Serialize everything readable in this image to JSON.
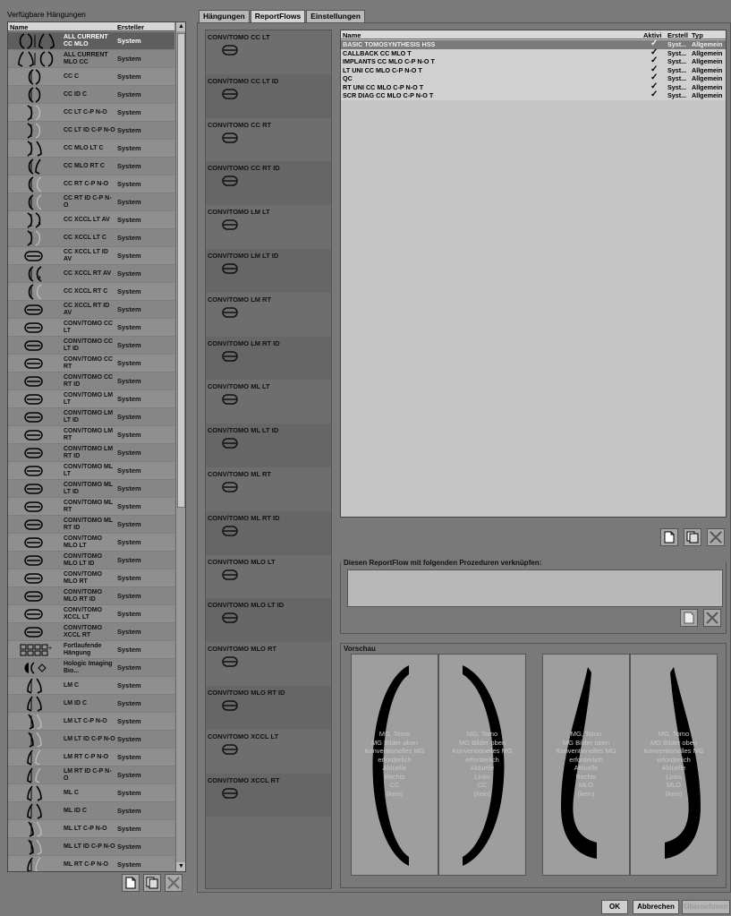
{
  "left": {
    "title": "Verfügbare Hängungen",
    "col_name": "Name",
    "col_creator": "Ersteller",
    "scroll_up": "▲",
    "scroll_down": "▼",
    "rows": [
      {
        "icon": "cc-mlo-pair-icon",
        "name": "ALL CURRENT CC MLO",
        "creator": "System",
        "selected": true
      },
      {
        "icon": "mlo-cc-pair-icon",
        "name": "ALL CURRENT MLO CC",
        "creator": "System"
      },
      {
        "icon": "cc-icon",
        "name": "CC C",
        "creator": "System"
      },
      {
        "icon": "cc-icon",
        "name": "CC ID C",
        "creator": "System"
      },
      {
        "icon": "cc-lt-icon",
        "name": "CC LT C-P N-O",
        "creator": "System"
      },
      {
        "icon": "cc-lt-icon",
        "name": "CC LT ID C-P N-O",
        "creator": "System"
      },
      {
        "icon": "cc-mlo-lt-icon",
        "name": "CC MLO LT C",
        "creator": "System"
      },
      {
        "icon": "cc-mlo-rt-icon",
        "name": "CC MLO RT C",
        "creator": "System"
      },
      {
        "icon": "cc-rt-icon",
        "name": "CC RT C-P N-O",
        "creator": "System"
      },
      {
        "icon": "cc-rt-icon",
        "name": "CC RT ID C-P N-O",
        "creator": "System"
      },
      {
        "icon": "cc-xccl-lt-icon",
        "name": "CC XCCL LT AV",
        "creator": "System"
      },
      {
        "icon": "cc-lt-icon",
        "name": "CC XCCL LT C",
        "creator": "System"
      },
      {
        "icon": "conv-tomo-icon",
        "name": "CC XCCL LT ID AV",
        "creator": "System"
      },
      {
        "icon": "cc-xccl-rt-icon",
        "name": "CC XCCL RT AV",
        "creator": "System"
      },
      {
        "icon": "cc-rt-icon",
        "name": "CC XCCL RT C",
        "creator": "System"
      },
      {
        "icon": "conv-tomo-icon",
        "name": "CC XCCL RT ID AV",
        "creator": "System"
      },
      {
        "icon": "conv-tomo-icon",
        "name": "CONV/TOMO CC LT",
        "creator": "System"
      },
      {
        "icon": "conv-tomo-icon",
        "name": "CONV/TOMO CC LT ID",
        "creator": "System"
      },
      {
        "icon": "conv-tomo-icon",
        "name": "CONV/TOMO CC RT",
        "creator": "System"
      },
      {
        "icon": "conv-tomo-icon",
        "name": "CONV/TOMO CC RT ID",
        "creator": "System"
      },
      {
        "icon": "conv-tomo-icon",
        "name": "CONV/TOMO LM LT",
        "creator": "System"
      },
      {
        "icon": "conv-tomo-icon",
        "name": "CONV/TOMO LM LT ID",
        "creator": "System"
      },
      {
        "icon": "conv-tomo-icon",
        "name": "CONV/TOMO LM RT",
        "creator": "System"
      },
      {
        "icon": "conv-tomo-icon",
        "name": "CONV/TOMO LM RT ID",
        "creator": "System"
      },
      {
        "icon": "conv-tomo-icon",
        "name": "CONV/TOMO ML LT",
        "creator": "System"
      },
      {
        "icon": "conv-tomo-icon",
        "name": "CONV/TOMO ML LT ID",
        "creator": "System"
      },
      {
        "icon": "conv-tomo-icon",
        "name": "CONV/TOMO ML RT",
        "creator": "System"
      },
      {
        "icon": "conv-tomo-icon",
        "name": "CONV/TOMO ML RT ID",
        "creator": "System"
      },
      {
        "icon": "conv-tomo-icon",
        "name": "CONV/TOMO MLO LT",
        "creator": "System"
      },
      {
        "icon": "conv-tomo-icon",
        "name": "CONV/TOMO MLO LT ID",
        "creator": "System"
      },
      {
        "icon": "conv-tomo-icon",
        "name": "CONV/TOMO MLO RT",
        "creator": "System"
      },
      {
        "icon": "conv-tomo-icon",
        "name": "CONV/TOMO MLO RT ID",
        "creator": "System"
      },
      {
        "icon": "conv-tomo-icon",
        "name": "CONV/TOMO XCCL LT",
        "creator": "System"
      },
      {
        "icon": "conv-tomo-icon",
        "name": "CONV/TOMO XCCL RT",
        "creator": "System"
      },
      {
        "icon": "grid-layout-icon",
        "name": "Fortlaufende Hängung",
        "creator": "System"
      },
      {
        "icon": "hologic-icon",
        "name": "Hologic Imaging Bio...",
        "creator": "System"
      },
      {
        "icon": "mlo-icon",
        "name": "LM C",
        "creator": "System"
      },
      {
        "icon": "mlo-icon",
        "name": "LM ID C",
        "creator": "System"
      },
      {
        "icon": "mlo-lt-icon",
        "name": "LM LT C-P N-O",
        "creator": "System"
      },
      {
        "icon": "mlo-lt-icon",
        "name": "LM LT ID C-P N-O",
        "creator": "System"
      },
      {
        "icon": "mlo-rt-icon",
        "name": "LM RT C-P N-O",
        "creator": "System"
      },
      {
        "icon": "mlo-rt-icon",
        "name": "LM RT ID C-P N-O",
        "creator": "System"
      },
      {
        "icon": "mlo-icon",
        "name": "ML C",
        "creator": "System"
      },
      {
        "icon": "mlo-icon",
        "name": "ML ID C",
        "creator": "System"
      },
      {
        "icon": "mlo-lt-icon",
        "name": "ML LT C-P N-O",
        "creator": "System"
      },
      {
        "icon": "mlo-lt-icon",
        "name": "ML LT ID C-P N-O",
        "creator": "System"
      },
      {
        "icon": "mlo-rt-icon",
        "name": "ML RT C-P N-O",
        "creator": "System"
      }
    ]
  },
  "tabs": [
    {
      "label": "Hängungen",
      "active": false
    },
    {
      "label": "ReportFlows",
      "active": true
    },
    {
      "label": "Einstellungen",
      "active": false
    }
  ],
  "flows": [
    "CONV/TOMO CC LT",
    "CONV/TOMO CC LT ID",
    "CONV/TOMO CC RT",
    "CONV/TOMO CC RT ID",
    "CONV/TOMO LM LT",
    "CONV/TOMO LM LT ID",
    "CONV/TOMO LM RT",
    "CONV/TOMO LM RT ID",
    "CONV/TOMO ML LT",
    "CONV/TOMO ML LT ID",
    "CONV/TOMO ML RT",
    "CONV/TOMO ML RT ID",
    "CONV/TOMO MLO LT",
    "CONV/TOMO MLO LT ID",
    "CONV/TOMO MLO RT",
    "CONV/TOMO MLO RT ID",
    "CONV/TOMO XCCL LT",
    "CONV/TOMO XCCL RT"
  ],
  "procedures": {
    "col_name": "Name",
    "col_active": "Aktivi",
    "col_creator": "Erstell",
    "col_type": "Typ",
    "check": "✓",
    "rows": [
      {
        "name": "BASIC TOMOSYNTHESIS HSS",
        "creator": "Syst...",
        "type": "Allgemein",
        "selected": true
      },
      {
        "name": "CALLBACK CC MLO T",
        "creator": "Syst...",
        "type": "Allgemein"
      },
      {
        "name": "IMPLANTS CC MLO C-P N-O T",
        "creator": "Syst...",
        "type": "Allgemein"
      },
      {
        "name": "LT UNI CC MLO C-P N-O T",
        "creator": "Syst...",
        "type": "Allgemein"
      },
      {
        "name": "QC",
        "creator": "Syst...",
        "type": "Allgemein"
      },
      {
        "name": "RT UNI CC MLO C-P N-O T",
        "creator": "Syst...",
        "type": "Allgemein"
      },
      {
        "name": "SCR DIAG CC MLO C-P N-O T",
        "creator": "Syst...",
        "type": "Allgemein"
      }
    ]
  },
  "link_label": "Diesen ReportFlow mit folgenden Prozeduren verknüpfen:",
  "preview": {
    "label": "Vorschau",
    "panes": [
      {
        "lines": [
          "MG, Tomo",
          "MG Bilder oben",
          "Konventionelles MG",
          "erforderlich",
          "Aktuelle",
          "Rechts",
          "CC",
          "(kein)"
        ]
      },
      {
        "lines": [
          "MG, Tomo",
          "MG Bilder oben",
          "Konventionelles MG",
          "erforderlich",
          "Aktuelle",
          "Links",
          "CC",
          "(kein)"
        ]
      },
      {
        "lines": [
          "MG, Tomo",
          "MG Bilder oben",
          "Konventionelles MG",
          "erforderlich",
          "Aktuelle",
          "Rechts",
          "MLO",
          "(kein)"
        ]
      },
      {
        "lines": [
          "MG, Tomo",
          "MG Bilder oben",
          "Konventionelles MG",
          "erforderlich",
          "Aktuelle",
          "Links",
          "MLO",
          "(kein)"
        ]
      }
    ]
  },
  "buttons": {
    "ok": "OK",
    "cancel": "Abbrechen",
    "apply": "Übernehmen"
  }
}
